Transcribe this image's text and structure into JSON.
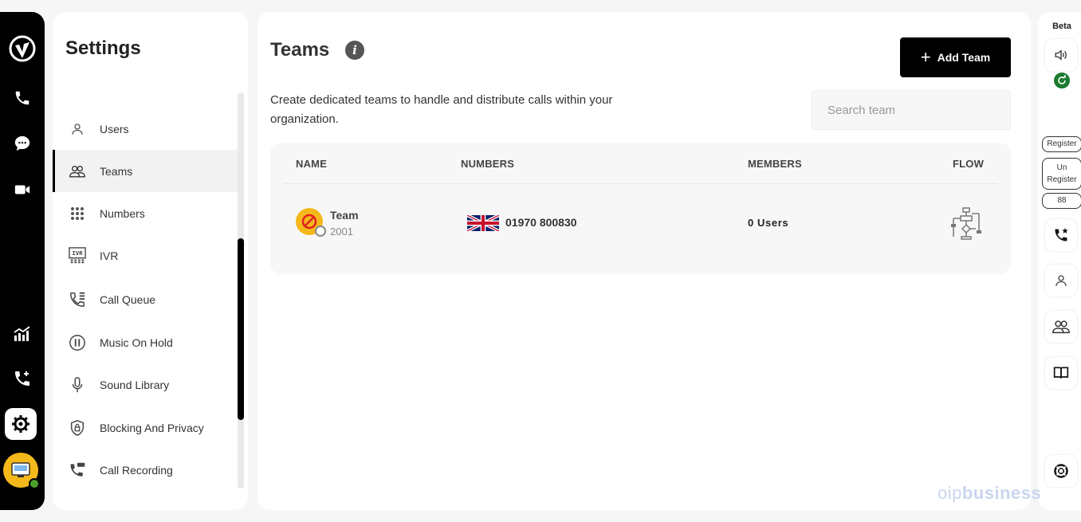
{
  "rail": {
    "icons": [
      "logo-icon",
      "phone-icon",
      "chat-icon",
      "video-icon",
      "analytics-icon",
      "phone-add-icon",
      "gear-icon",
      "avatar"
    ]
  },
  "settings": {
    "title": "Settings",
    "items": [
      {
        "label": "Users",
        "icon": "user-icon"
      },
      {
        "label": "Teams",
        "icon": "team-icon",
        "active": true
      },
      {
        "label": "Numbers",
        "icon": "dialpad-icon"
      },
      {
        "label": "IVR",
        "icon": "ivr-icon"
      },
      {
        "label": "Call Queue",
        "icon": "call-queue-icon"
      },
      {
        "label": "Music On Hold",
        "icon": "pause-icon"
      },
      {
        "label": "Sound Library",
        "icon": "microphone-icon"
      },
      {
        "label": "Blocking And Privacy",
        "icon": "shield-lock-icon"
      },
      {
        "label": "Call Recording",
        "icon": "call-recording-icon"
      }
    ]
  },
  "main": {
    "title": "Teams",
    "description": "Create dedicated teams to handle and distribute calls within your organization.",
    "add_button": "Add Team",
    "search_placeholder": "Search team",
    "table": {
      "headers": {
        "name": "NAME",
        "numbers": "NUMBERS",
        "members": "MEMBERS",
        "flow": "FLOW"
      },
      "rows": [
        {
          "name": "Team",
          "ext": "2001",
          "number": "01970 800830",
          "members": "0 Users"
        }
      ]
    }
  },
  "right_rail": {
    "beta": "Beta",
    "register": "Register",
    "unregister": "Un Register",
    "count": "88"
  },
  "watermark": {
    "prefix": "oip",
    "suffix": "business"
  }
}
